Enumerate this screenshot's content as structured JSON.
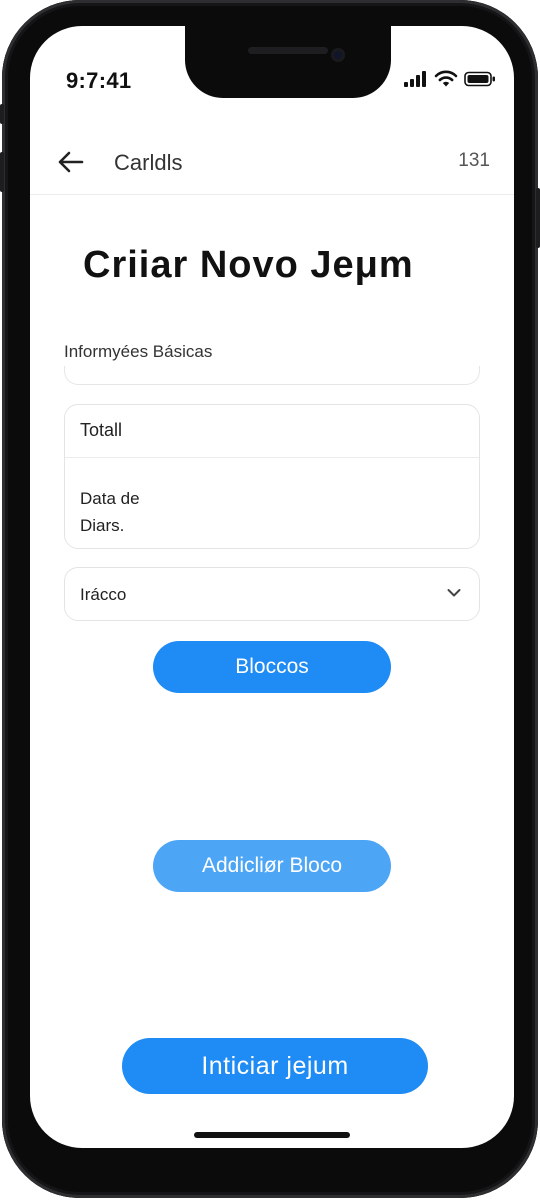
{
  "status_bar": {
    "time": "9:7:41"
  },
  "header": {
    "title": "Carldls",
    "count": "131"
  },
  "page": {
    "title": "Criiar Novo Jeμm",
    "section_label": "Informyées Básicas"
  },
  "form": {
    "total_label": "Totall",
    "data_label_line1": "Data de",
    "data_label_line2": "Diars.",
    "select_value": "Irácco"
  },
  "buttons": {
    "blocos": "Bloccos",
    "add_block": "Addicliør Bloco",
    "start": "Inticiar jejum"
  },
  "colors": {
    "primary": "#1f8bf4",
    "primary_light": "#4da5f6",
    "bezel": "#0b0b0c"
  }
}
